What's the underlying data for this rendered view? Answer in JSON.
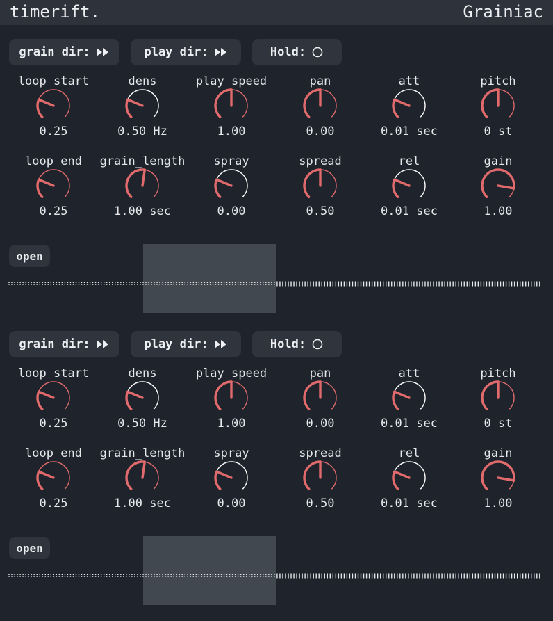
{
  "header": {
    "brand": "timerift.",
    "app_title": "Grainiac"
  },
  "colors": {
    "accent": "#e06a6c",
    "background": "#1f232b",
    "panel": "#30343c",
    "selection": "#424850"
  },
  "icons": {
    "direction": "fast-forward-icon",
    "hold": "empty-circle-icon"
  },
  "sections": [
    {
      "grain_dir_label": "grain dir:",
      "play_dir_label": "play dir:",
      "hold_label": "Hold:",
      "open_label": "open",
      "knobs_row1": [
        {
          "label": "loop start",
          "value": "0.25",
          "level": 0.25,
          "dial": "#e06a6c"
        },
        {
          "label": "dens",
          "value": "0.50 Hz",
          "level": 0.25,
          "dial": "#ffffff"
        },
        {
          "label": "play speed",
          "value": "1.00",
          "level": 0.5,
          "dial": "#e06a6c"
        },
        {
          "label": "pan",
          "value": "0.00",
          "level": 0.5,
          "dial": "#e06a6c"
        },
        {
          "label": "att",
          "value": "0.01 sec",
          "level": 0.25,
          "dial": "#ffffff"
        },
        {
          "label": "pitch",
          "value": "0 st",
          "level": 0.5,
          "dial": "#e06a6c"
        }
      ],
      "knobs_row2": [
        {
          "label": "loop end",
          "value": "0.25",
          "level": 0.25,
          "dial": "#e06a6c"
        },
        {
          "label": "grain_length",
          "value": "1.00 sec",
          "level": 0.53,
          "dial": "#e06a6c"
        },
        {
          "label": "spray",
          "value": "0.00",
          "level": 0.25,
          "dial": "#ffffff"
        },
        {
          "label": "spread",
          "value": "0.50",
          "level": 0.5,
          "dial": "#e06a6c"
        },
        {
          "label": "rel",
          "value": "0.01 sec",
          "level": 0.25,
          "dial": "#ffffff"
        },
        {
          "label": "gain",
          "value": "1.00",
          "level": 0.87,
          "dial": "#e06a6c"
        }
      ]
    },
    {
      "grain_dir_label": "grain dir:",
      "play_dir_label": "play dir:",
      "hold_label": "Hold:",
      "open_label": "open",
      "knobs_row1": [
        {
          "label": "loop start",
          "value": "0.25",
          "level": 0.25,
          "dial": "#e06a6c"
        },
        {
          "label": "dens",
          "value": "0.50 Hz",
          "level": 0.25,
          "dial": "#ffffff"
        },
        {
          "label": "play speed",
          "value": "1.00",
          "level": 0.5,
          "dial": "#e06a6c"
        },
        {
          "label": "pan",
          "value": "0.00",
          "level": 0.5,
          "dial": "#e06a6c"
        },
        {
          "label": "att",
          "value": "0.01 sec",
          "level": 0.25,
          "dial": "#ffffff"
        },
        {
          "label": "pitch",
          "value": "0 st",
          "level": 0.5,
          "dial": "#e06a6c"
        }
      ],
      "knobs_row2": [
        {
          "label": "loop end",
          "value": "0.25",
          "level": 0.25,
          "dial": "#e06a6c"
        },
        {
          "label": "grain_length",
          "value": "1.00 sec",
          "level": 0.53,
          "dial": "#e06a6c"
        },
        {
          "label": "spray",
          "value": "0.00",
          "level": 0.25,
          "dial": "#ffffff"
        },
        {
          "label": "spread",
          "value": "0.50",
          "level": 0.5,
          "dial": "#e06a6c"
        },
        {
          "label": "rel",
          "value": "0.01 sec",
          "level": 0.25,
          "dial": "#ffffff"
        },
        {
          "label": "gain",
          "value": "1.00",
          "level": 0.87,
          "dial": "#e06a6c"
        }
      ]
    }
  ]
}
